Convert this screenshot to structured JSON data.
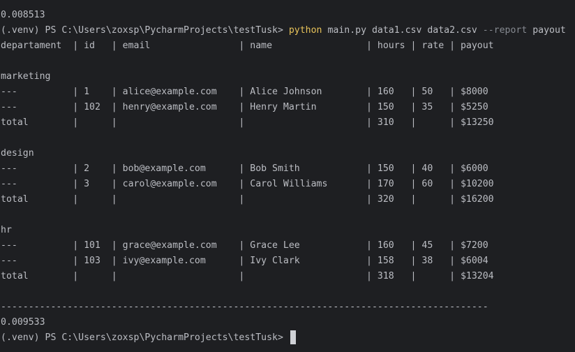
{
  "terminal": {
    "top_separator": "----------------------------------------------------------------------------------",
    "time1": "0.008513",
    "prompt": "(.venv) PS C:\\Users\\zoxsp\\PycharmProjects\\testTusk> ",
    "command": "python",
    "args": " main.py data1.csv data2.csv ",
    "flag": "--report",
    "flag_value": " payout",
    "header": "departament  | id   | email                | name                 | hours | rate | payout",
    "rows": [
      "",
      "marketing",
      "---          | 1    | alice@example.com    | Alice Johnson        | 160   | 50   | $8000",
      "---          | 102  | henry@example.com    | Henry Martin         | 150   | 35   | $5250",
      "total        |      |                      |                      | 310   |      | $13250",
      "",
      "design",
      "---          | 2    | bob@example.com      | Bob Smith            | 150   | 40   | $6000",
      "---          | 3    | carol@example.com    | Carol Williams       | 170   | 60   | $10200",
      "total        |      |                      |                      | 320   |      | $16200",
      "",
      "hr",
      "---          | 101  | grace@example.com    | Grace Lee            | 160   | 45   | $7200",
      "---          | 103  | ivy@example.com      | Ivy Clark            | 158   | 38   | $6004",
      "total        |      |                      |                      | 318   |      | $13204",
      ""
    ],
    "separator": "----------------------------------------------------------------------------------------",
    "time2": "0.009533",
    "prompt2": "(.venv) PS C:\\Users\\zoxsp\\PycharmProjects\\testTusk> "
  }
}
